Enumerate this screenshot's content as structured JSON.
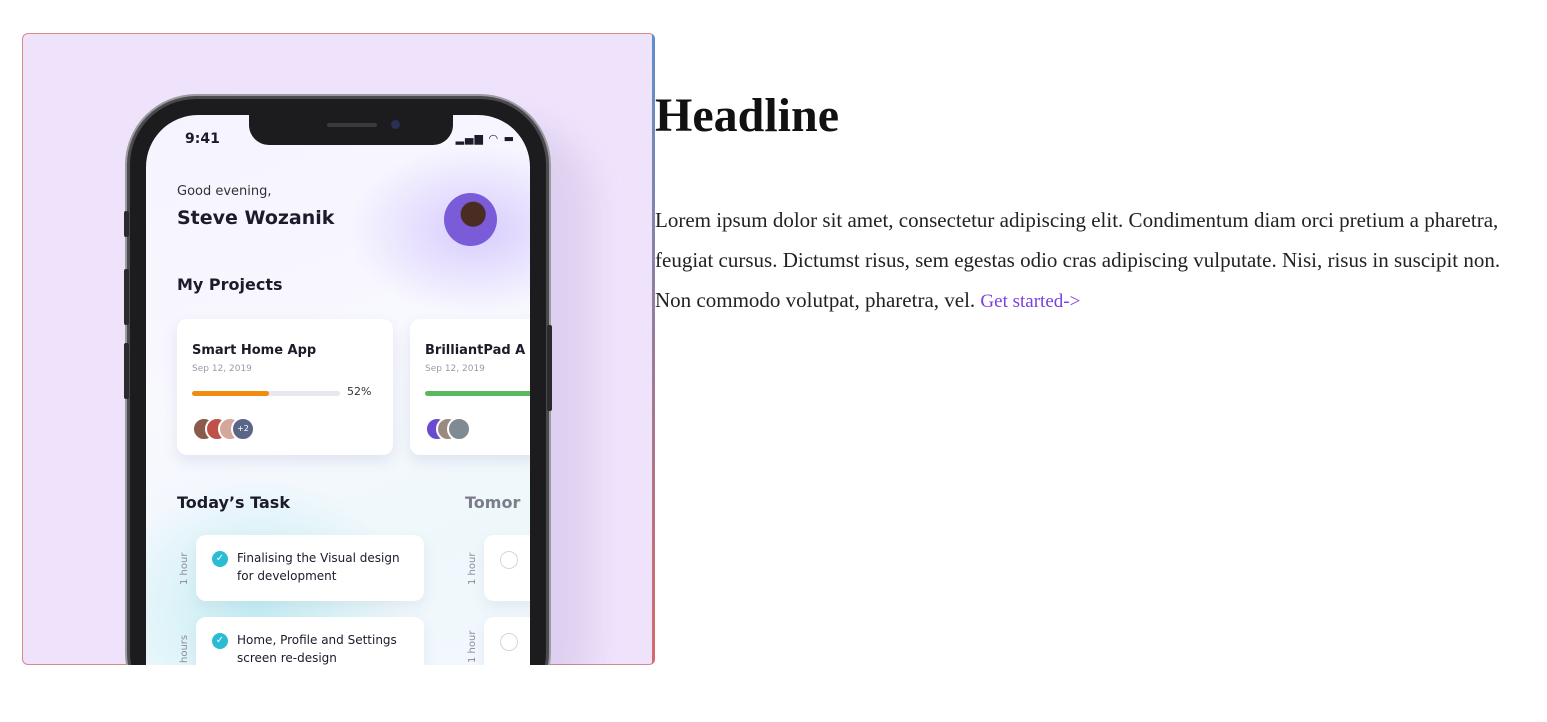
{
  "hero": {
    "phone": {
      "status_time": "9:41",
      "greeting": "Good evening,",
      "user_name": "Steve Wozanik",
      "projects_title": "My Projects",
      "projects": [
        {
          "title": "Smart Home App",
          "date": "Sep 12, 2019",
          "progress_pct": 52,
          "progress_label": "52%",
          "bar_color": "#f28c0f",
          "more_count": "+2"
        },
        {
          "title": "BrilliantPad A",
          "date": "Sep 12, 2019",
          "progress_pct": 100,
          "bar_color": "#5cb85c"
        }
      ],
      "today_title": "Today’s Task",
      "tomorrow_title": "Tomor",
      "tasks": [
        {
          "duration": "1 hour",
          "text_line1": "Finalising the Visual design",
          "text_line2": "for development"
        },
        {
          "duration": "hours",
          "text_line1": "Home, Profile and Settings",
          "text_line2": "screen re-design"
        }
      ],
      "tomorrow_tasks": [
        {
          "duration": "1 hour"
        },
        {
          "duration": "1 hour"
        }
      ]
    }
  },
  "content": {
    "headline": "Headline",
    "body": "Lorem ipsum dolor sit amet, consectetur adipiscing elit. Condimentum diam orci pretium a pharetra, feugiat cursus. Dictumst risus, sem egestas odio cras adipiscing vulputate. Nisi, risus in suscipit non. Non commodo volutpat, pharetra, vel.",
    "cta_label": "Get started->"
  },
  "colors": {
    "hero_background": "#efe3fc",
    "link": "#7a3fe0",
    "check": "#2bbcd4"
  }
}
